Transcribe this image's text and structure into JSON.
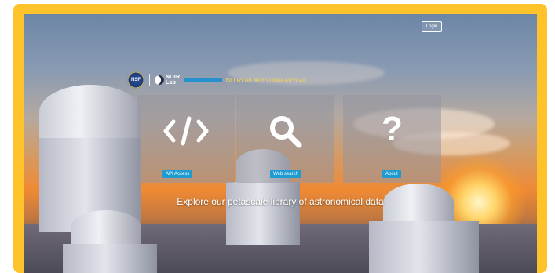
{
  "header": {
    "login_label": "Login"
  },
  "brand": {
    "seal_text": "NSF",
    "noir_text_line1": "NOIR",
    "noir_text_line2": "Lab",
    "title": "NOIRLab Astro Data Archive"
  },
  "cards": [
    {
      "icon": "code-icon",
      "glyph": "</>",
      "button_label": "API Access"
    },
    {
      "icon": "search-icon",
      "glyph": "",
      "button_label": "Web search"
    },
    {
      "icon": "question-icon",
      "glyph": "?",
      "button_label": "About"
    }
  ],
  "tagline": "Explore our petascale library of astronomical data",
  "colors": {
    "frame": "#fec22b",
    "button_blue": "#1f9bd1",
    "title_yellow": "#f4d25a"
  }
}
